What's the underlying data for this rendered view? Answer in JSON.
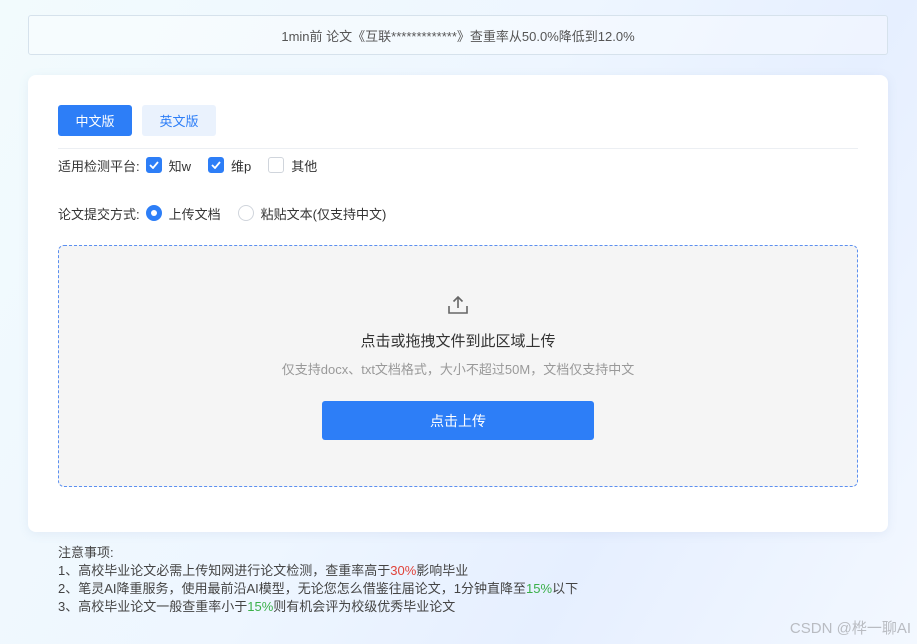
{
  "notice": "1min前 论文《互联*************》查重率从50.0%降低到12.0%",
  "tabs": [
    {
      "label": "中文版",
      "active": true
    },
    {
      "label": "英文版",
      "active": false
    }
  ],
  "platform": {
    "label": "适用检测平台:",
    "options": [
      {
        "label": "知w",
        "checked": true
      },
      {
        "label": "维p",
        "checked": true
      },
      {
        "label": "其他",
        "checked": false
      }
    ]
  },
  "submit": {
    "label": "论文提交方式:",
    "options": [
      {
        "label": "上传文档",
        "selected": true
      },
      {
        "label": "粘贴文本(仅支持中文)",
        "selected": false
      }
    ]
  },
  "dropzone": {
    "title": "点击或拖拽文件到此区域上传",
    "hint": "仅支持docx、txt文档格式，大小不超过50M，文档仅支持中文",
    "button": "点击上传"
  },
  "notes": {
    "title": "注意事项:",
    "line1_a": "1、高校毕业论文必需上传知网进行论文检测，查重率高于",
    "line1_b": "30%",
    "line1_c": "影响毕业",
    "line2_a": "2、笔灵AI降重服务，使用最前沿AI模型，无论您怎么借鉴往届论文，1分钟直降至",
    "line2_b": "15%",
    "line2_c": "以下",
    "line3_a": "3、高校毕业论文一般查重率小于",
    "line3_b": "15%",
    "line3_c": "则有机会评为校级优秀毕业论文"
  },
  "watermark": "CSDN @桦一聊AI",
  "colors": {
    "primary": "#2d7ef7",
    "red": "#e0433a",
    "green": "#3bb04a"
  }
}
